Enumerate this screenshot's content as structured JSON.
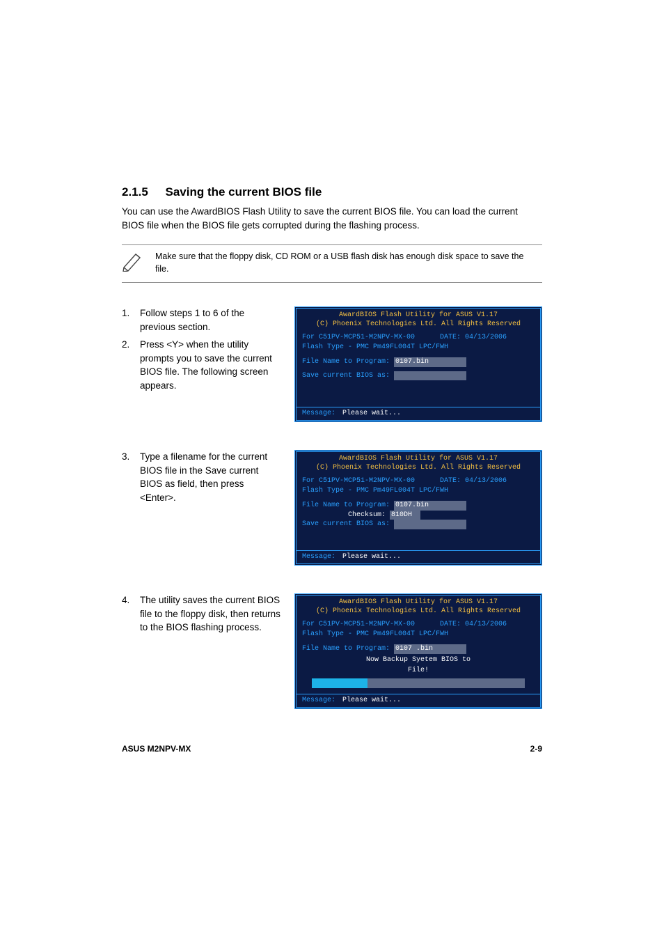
{
  "section": {
    "number": "2.1.5",
    "title": "Saving the current BIOS file"
  },
  "intro": "You can use the AwardBIOS Flash Utility to save the current BIOS file. You can load the current BIOS file when the BIOS file gets corrupted during the flashing process.",
  "note": "Make sure that the floppy disk, CD ROM or a USB flash disk has enough disk space to save the file.",
  "steps": {
    "s1": {
      "n": "1.",
      "t": "Follow steps 1 to 6 of the previous section."
    },
    "s2": {
      "n": "2.",
      "t": "Press <Y> when the utility prompts you to save the current BIOS file. The following screen appears."
    },
    "s3": {
      "n": "3.",
      "t": "Type a filename for the current BIOS file in the Save current BIOS as field, then press <Enter>."
    },
    "s4": {
      "n": "4.",
      "t": "The utility saves the current BIOS file to the floppy disk, then returns to the BIOS flashing process."
    }
  },
  "bios": {
    "hdr1": "AwardBIOS Flash Utility for ASUS V1.17",
    "hdr2": "(C) Phoenix Technologies Ltd. All Rights Reserved",
    "board": "For C51PV-MCP51-M2NPV-MX-00",
    "date": "DATE: 04/13/2006",
    "flash": "Flash Type - PMC Pm49FL004T LPC/FWH",
    "fileLabel": "File Name to Program:",
    "fileVal1": "0107.bin",
    "fileVal3": "0107 .bin",
    "checksumLabel": "Checksum:",
    "checksumVal": "810DH",
    "saveLabel": "Save current BIOS as:",
    "backup1": "Now Backup Syetem BIOS to",
    "backup2": "File!",
    "msgLabel": "Message:",
    "msgVal": "Please wait..."
  },
  "footer": {
    "left": "ASUS M2NPV-MX",
    "right": "2-9"
  }
}
